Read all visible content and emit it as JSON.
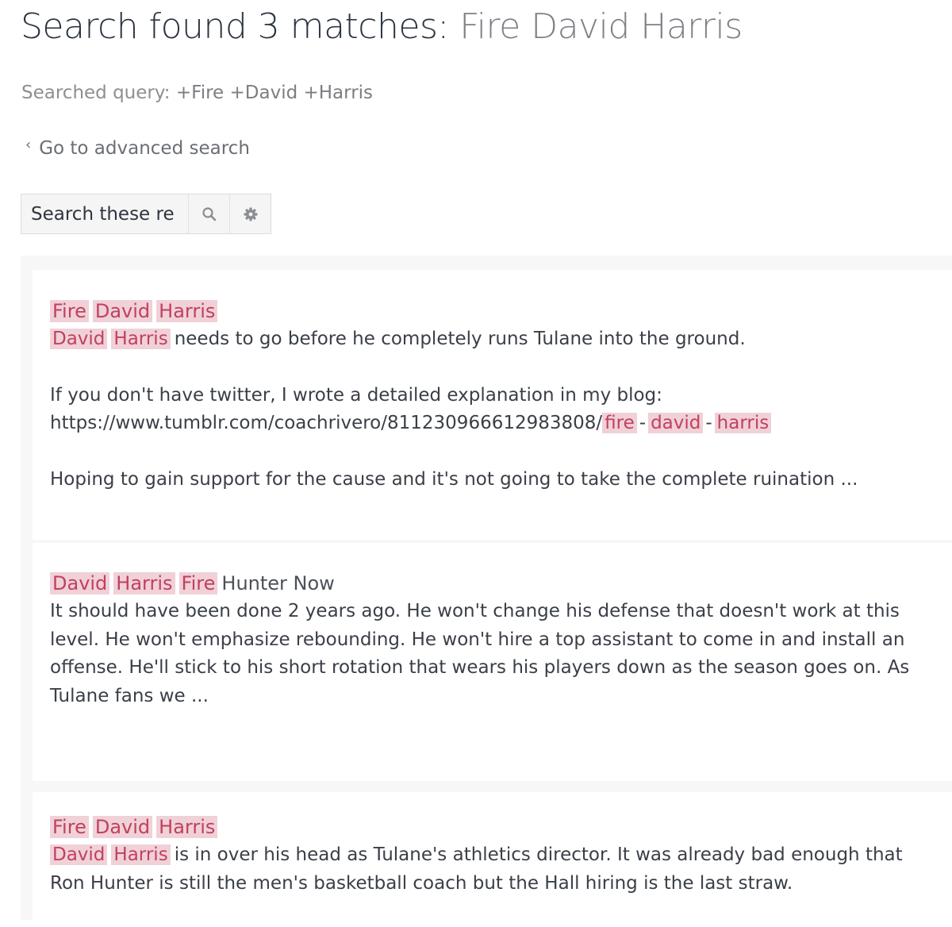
{
  "header": {
    "title_prefix": "Search found 3 matches:",
    "title_query": "Fire David Harris"
  },
  "searched_query": {
    "label": "Searched query:",
    "terms": "+Fire +David +Harris"
  },
  "advanced_link": {
    "chevron": "‹",
    "label": "Go to advanced search"
  },
  "search_box": {
    "value": "Search these re",
    "search_icon": "search-icon",
    "settings_icon": "gear-icon"
  },
  "colors": {
    "highlight_bg": "#f0d1d8",
    "highlight_text": "#c2405e",
    "panel_bg": "#f7f7f7"
  },
  "results": [
    {
      "title_terms": [
        "Fire",
        "David",
        "Harris"
      ],
      "title_rest": "",
      "body_terms": [
        "David",
        "Harris"
      ],
      "body_line1": "needs to go before he completely runs Tulane into the ground.",
      "body_line2": "If you don't have twitter, I wrote a detailed explanation in my blog:",
      "url_prefix": "https://www.tumblr.com/coachrivero/811230966612983808/",
      "url_terms": [
        "fire",
        "david",
        "harris"
      ],
      "url_sep": "-",
      "body_line3": "Hoping to gain support for the cause and it's not going to take the complete ruination ..."
    },
    {
      "title_terms": [
        "David",
        "Harris",
        "Fire"
      ],
      "title_rest": "Hunter Now",
      "body_text": "It should have been done 2 years ago. He won't change his defense that doesn't work at this level. He won't emphasize rebounding. He won't hire a top assistant to come in and install an offense. He'll stick to his short rotation that wears his players down as the season goes on. As Tulane fans we ..."
    },
    {
      "title_terms": [
        "Fire",
        "David",
        "Harris"
      ],
      "title_rest": "",
      "body_terms": [
        "David",
        "Harris"
      ],
      "body_text": "is in over his head as Tulane's athletics director. It was already bad enough that Ron Hunter is still the men's basketball coach but the Hall hiring is the last straw."
    }
  ]
}
